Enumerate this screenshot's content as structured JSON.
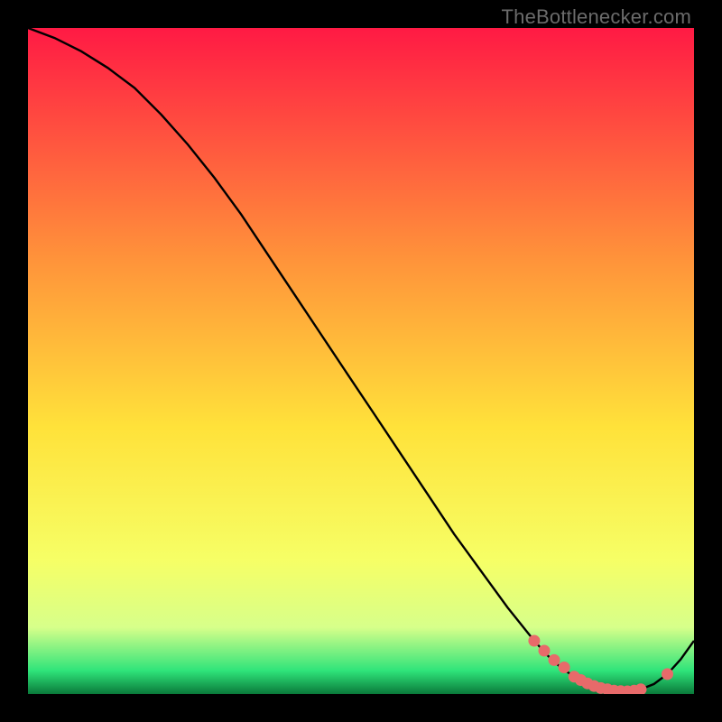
{
  "watermark": "TheBottlenecker.com",
  "colors": {
    "frame": "#000000",
    "curve": "#000000",
    "marker": "#e86a6a",
    "grad_top": "#ff1a44",
    "grad_mid_upper": "#ff943a",
    "grad_mid": "#ffe23a",
    "grad_mid_lower": "#f6ff66",
    "grad_low": "#d7ff8a",
    "grad_green": "#2fe47a",
    "grad_bottom": "#0a7a3a"
  },
  "chart_data": {
    "type": "line",
    "title": "",
    "xlabel": "",
    "ylabel": "",
    "xlim": [
      0,
      100
    ],
    "ylim": [
      0,
      100
    ],
    "series": [
      {
        "name": "curve",
        "x": [
          0,
          4,
          8,
          12,
          16,
          20,
          24,
          28,
          32,
          36,
          40,
          44,
          48,
          52,
          56,
          60,
          64,
          68,
          72,
          76,
          78,
          80,
          82,
          84,
          86,
          88,
          90,
          92,
          94,
          96,
          98,
          100
        ],
        "y": [
          100,
          98.5,
          96.5,
          94,
          91,
          87,
          82.5,
          77.5,
          72,
          66,
          60,
          54,
          48,
          42,
          36,
          30,
          24,
          18.5,
          13,
          8,
          5.8,
          4,
          2.6,
          1.6,
          0.9,
          0.5,
          0.4,
          0.7,
          1.5,
          3,
          5.2,
          8
        ]
      }
    ],
    "markers": {
      "name": "highlight-points",
      "x": [
        76,
        77.5,
        79,
        80.5,
        82,
        83,
        84,
        85,
        86,
        87,
        88,
        89,
        90,
        91,
        92,
        96
      ],
      "y": [
        8,
        6.5,
        5.1,
        4,
        2.6,
        2.1,
        1.6,
        1.2,
        0.9,
        0.7,
        0.5,
        0.45,
        0.4,
        0.5,
        0.7,
        3
      ]
    }
  }
}
